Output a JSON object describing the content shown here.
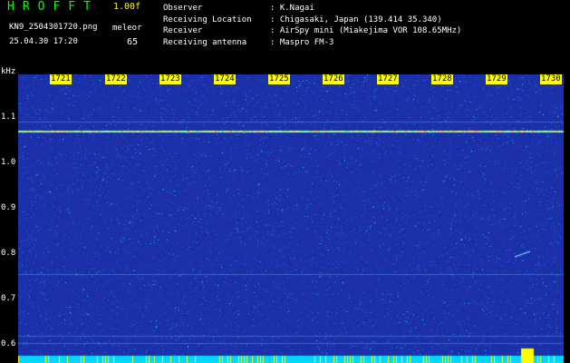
{
  "app": {
    "title": "HROFFT",
    "version": "1.00f",
    "filename": "KN9_2504301720.png",
    "meteor_label": "meleor",
    "datetime": "25.04.30 17:20",
    "meteor_count": "65"
  },
  "info": [
    {
      "label": "Observer",
      "value": ": K.Nagai"
    },
    {
      "label": "Receiving Location",
      "value": ": Chigasaki, Japan (139.414 35.340)"
    },
    {
      "label": "Receiver",
      "value": ": AirSpy mini (Miakejima VOR 108.65MHz)"
    },
    {
      "label": "Receiving antenna",
      "value": ": Maspro FM-3"
    }
  ],
  "axis": {
    "unit": "kHz",
    "y_ticks": [
      "1.1",
      "1.0",
      "0.9",
      "0.8",
      "0.7",
      "0.6"
    ],
    "x_ticks": [
      "1721",
      "1722",
      "1723",
      "1724",
      "1725",
      "1726",
      "1727",
      "1728",
      "1729",
      "1730"
    ]
  },
  "colors": {
    "background": "#1a2fa8",
    "noise_high": "#00ffff",
    "accent": "#ffff00",
    "title": "#00ff00"
  }
}
